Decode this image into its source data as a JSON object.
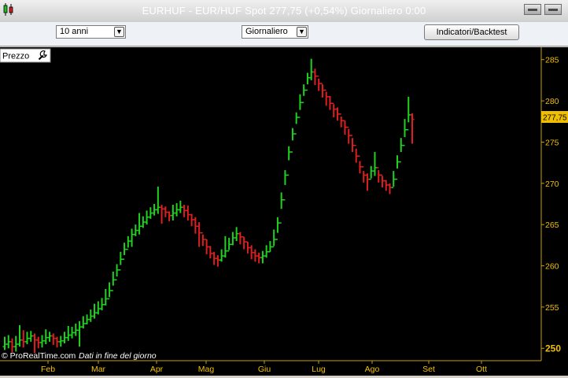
{
  "window": {
    "title": "EURHUF - EUR/HUF Spot    277,75 (+0,54%)    Giornaliero  0:00"
  },
  "toolbar": {
    "period_value": "10 anni",
    "timeframe_value": "Giornaliero",
    "indicators_label": "Indicatori/Backtest"
  },
  "panel": {
    "label": "Prezzo",
    "footer_copyright": "© ProRealTime.com",
    "footer_note": "Dati in fine del giorno",
    "current_price_label": "277,75"
  },
  "colors": {
    "background": "#000000",
    "up": "#1fd21f",
    "down": "#dd1f1f",
    "axis_text": "#f0c000",
    "price_tag_bg": "#f0c000"
  },
  "chart_data": {
    "type": "ohlc",
    "title": "EURHUF - EUR/HUF Spot",
    "ylim": [
      248.5,
      286.5
    ],
    "grid": false,
    "x_axis_labels": [
      "Feb",
      "Mar",
      "Apr",
      "Mag",
      "Giu",
      "Lug",
      "Ago",
      "Set",
      "Ott"
    ],
    "y_axis_labels": [
      "250",
      "255",
      "260",
      "265",
      "270",
      "275",
      "280",
      "285"
    ],
    "y_ticks": [
      250,
      255,
      260,
      265,
      270,
      275,
      280,
      285
    ],
    "current_price": 277.75,
    "close_series": [
      250.5,
      250.8,
      250.2,
      250.5,
      251.0,
      250.8,
      251.2,
      251.5,
      251.0,
      250.7,
      250.9,
      251.3,
      251.5,
      251.2,
      250.8,
      250.9,
      251.3,
      251.6,
      251.9,
      252.2,
      252.6,
      253.0,
      253.5,
      253.9,
      254.3,
      254.8,
      255.3,
      256.0,
      257.0,
      258.3,
      259.5,
      260.8,
      262.0,
      263.0,
      263.8,
      264.3,
      264.8,
      265.3,
      265.9,
      266.4,
      266.8,
      267.1,
      266.9,
      266.5,
      266.1,
      266.4,
      266.8,
      267.1,
      266.7,
      266.2,
      265.6,
      264.8,
      264.0,
      263.2,
      262.3,
      261.5,
      260.9,
      260.7,
      261.2,
      261.8,
      262.6,
      263.4,
      263.9,
      263.5,
      262.9,
      262.2,
      261.6,
      261.2,
      261.0,
      261.2,
      261.7,
      262.3,
      263.2,
      265.2,
      268.0,
      271.0,
      273.8,
      276.0,
      278.0,
      279.8,
      281.3,
      282.8,
      283.5,
      283.0,
      282.1,
      281.3,
      280.5,
      279.7,
      279.0,
      278.4,
      277.6,
      276.8,
      275.8,
      274.6,
      273.3,
      272.0,
      271.0,
      270.5,
      271.5,
      271.9,
      271.0,
      270.3,
      269.8,
      269.5,
      270.5,
      272.6,
      274.6,
      276.5,
      278.3,
      277.75
    ],
    "high_series": [
      251.4,
      251.6,
      251.2,
      251.5,
      252.8,
      252.2,
      252.0,
      252.1,
      251.8,
      251.4,
      251.6,
      252.3,
      252.0,
      251.8,
      251.4,
      251.5,
      252.0,
      252.7,
      252.6,
      253.0,
      253.3,
      253.9,
      254.1,
      254.7,
      255.4,
      255.7,
      256.1,
      257.2,
      258.0,
      259.3,
      260.2,
      261.7,
      262.8,
      263.6,
      264.5,
      265.0,
      266.4,
      266.0,
      266.7,
      267.1,
      267.5,
      269.6,
      267.4,
      267.2,
      266.6,
      267.4,
      267.6,
      267.9,
      267.4,
      267.3,
      266.3,
      265.9,
      265.3,
      263.8,
      263.2,
      262.4,
      261.7,
      261.3,
      262.0,
      263.6,
      263.4,
      264.1,
      264.7,
      264.1,
      263.5,
      262.9,
      262.5,
      262.0,
      261.6,
      261.8,
      262.5,
      263.0,
      264.4,
      265.9,
      268.9,
      271.6,
      274.5,
      276.7,
      278.6,
      280.8,
      282.0,
      283.4,
      285.1,
      283.9,
      282.7,
      282.0,
      281.1,
      280.6,
      279.6,
      279.2,
      278.1,
      277.6,
      276.6,
      275.5,
      274.2,
      272.7,
      271.5,
      271.2,
      272.1,
      273.8,
      271.6,
      270.9,
      270.4,
      270.0,
      271.5,
      273.4,
      275.5,
      277.8,
      280.5,
      278.5
    ],
    "low_series": [
      249.8,
      250.0,
      249.5,
      249.6,
      250.2,
      250.1,
      250.5,
      250.8,
      249.4,
      250.0,
      250.1,
      250.5,
      250.8,
      250.4,
      250.1,
      250.2,
      250.6,
      250.9,
      251.2,
      251.5,
      250.2,
      252.4,
      252.9,
      253.2,
      253.6,
      254.1,
      254.6,
      255.2,
      256.2,
      257.6,
      258.7,
      260.1,
      261.3,
      262.2,
      262.3,
      263.6,
      263.8,
      264.6,
      265.0,
      265.7,
      266.1,
      266.3,
      265.1,
      265.9,
      265.4,
      265.5,
      266.0,
      266.4,
      265.9,
      265.5,
      264.8,
      263.9,
      262.3,
      262.4,
      261.4,
      260.9,
      260.1,
      259.9,
      260.5,
      261.0,
      261.9,
      262.5,
      263.0,
      262.6,
      262.0,
      261.5,
      260.8,
      260.5,
      260.3,
      260.3,
      261.0,
      261.7,
      262.4,
      264.0,
      266.9,
      269.8,
      272.8,
      275.2,
      277.2,
      278.9,
      280.6,
      282.0,
      282.5,
      281.9,
      281.2,
      280.4,
      279.4,
      278.9,
      278.0,
      277.6,
      276.8,
      275.9,
      274.8,
      273.8,
      272.5,
      271.2,
      270.1,
      269.1,
      270.6,
      270.9,
      270.1,
      269.5,
      269.1,
      268.7,
      269.6,
      271.8,
      273.8,
      275.6,
      277.4,
      274.8
    ]
  }
}
